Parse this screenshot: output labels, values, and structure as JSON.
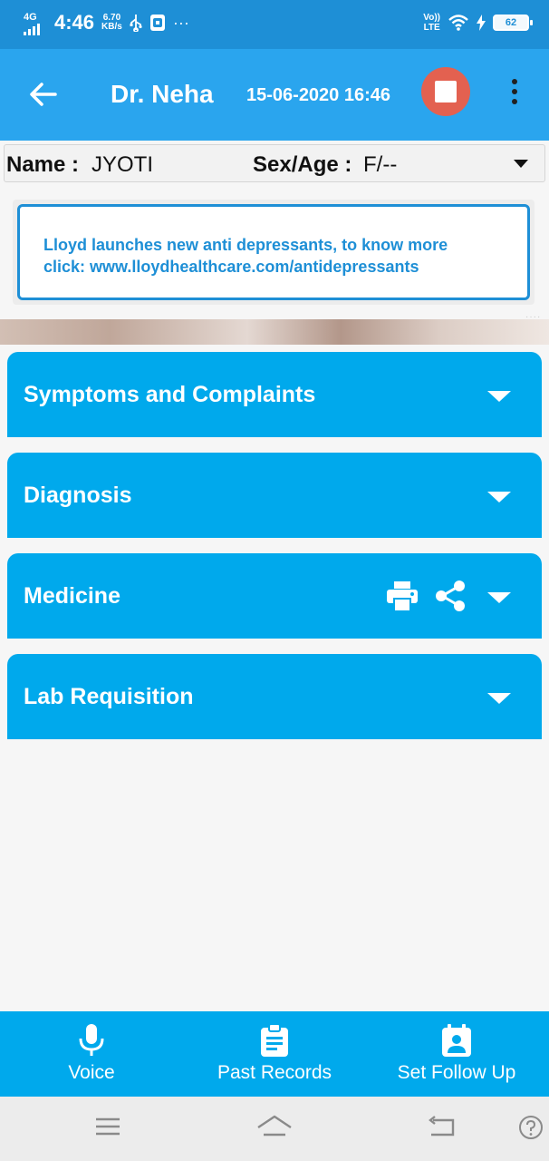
{
  "status_bar": {
    "network_type": "4G",
    "time": "4:46",
    "speed_value": "6.70",
    "speed_unit": "KB/s",
    "more_indicator": "···",
    "volte_top": "Vo))",
    "volte_bottom": "LTE",
    "battery_level": "62"
  },
  "app_bar": {
    "doctor_name": "Dr. Neha",
    "datetime": "15-06-2020 16:46",
    "icons": [
      "back-arrow",
      "stop",
      "more-vert"
    ]
  },
  "patient": {
    "name_label": "Name :",
    "name_value": "JYOTI",
    "sex_age_label": "Sex/Age :",
    "sex_age_value": "F/--"
  },
  "ad": {
    "line1": "Lloyd launches new anti depressants, to know more",
    "line2": "click: www.lloydhealthcare.com/antidepressants"
  },
  "sections": [
    {
      "title": "Symptoms and Complaints"
    },
    {
      "title": "Diagnosis"
    },
    {
      "title": "Medicine",
      "icons": [
        "print-icon",
        "share-icon"
      ]
    },
    {
      "title": "Lab Requisition"
    }
  ],
  "actions": [
    {
      "label": "Voice",
      "icon": "microphone-icon"
    },
    {
      "label": "Past Records",
      "icon": "clipboard-icon"
    },
    {
      "label": "Set Follow Up",
      "icon": "calendar-person-icon"
    }
  ],
  "colors": {
    "status_bar": "#1e8fd6",
    "app_bar": "#2aa5ee",
    "section": "#00a9ec",
    "stop_button": "#e36150",
    "ad_text": "#1e8fd6"
  }
}
